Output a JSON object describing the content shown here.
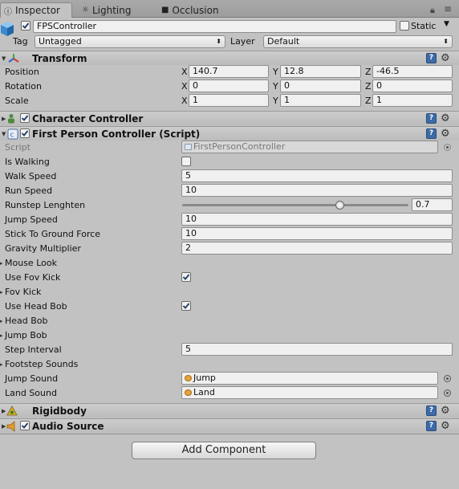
{
  "tabs": [
    {
      "label": "Inspector",
      "icon": "info-icon"
    },
    {
      "label": "Lighting",
      "icon": "lighting-icon"
    },
    {
      "label": "Occlusion",
      "icon": "occlusion-icon"
    }
  ],
  "header": {
    "object_name": "FPSController",
    "active": true,
    "static_label": "Static",
    "tag_label": "Tag",
    "tag_value": "Untagged",
    "layer_label": "Layer",
    "layer_value": "Default"
  },
  "transform": {
    "title": "Transform",
    "position_label": "Position",
    "rotation_label": "Rotation",
    "scale_label": "Scale",
    "x": "X",
    "y": "Y",
    "z": "Z",
    "position": {
      "x": "140.7",
      "y": "12.8",
      "z": "-46.5"
    },
    "rotation": {
      "x": "0",
      "y": "0",
      "z": "0"
    },
    "scale": {
      "x": "1",
      "y": "1",
      "z": "1"
    }
  },
  "character_controller": {
    "title": "Character Controller",
    "enabled": true
  },
  "fps_controller": {
    "title": "First Person Controller (Script)",
    "enabled": true,
    "script_label": "Script",
    "script_value": "FirstPersonController",
    "is_walking_label": "Is Walking",
    "walk_speed_label": "Walk Speed",
    "walk_speed": "5",
    "run_speed_label": "Run Speed",
    "run_speed": "10",
    "runstep_label": "Runstep Lenghten",
    "runstep_value": "0.7",
    "runstep_fraction": 0.7,
    "jump_speed_label": "Jump Speed",
    "jump_speed": "10",
    "stick_label": "Stick To Ground Force",
    "stick_value": "10",
    "gravity_label": "Gravity Multiplier",
    "gravity_value": "2",
    "mouse_look_label": "Mouse Look",
    "use_fov_kick_label": "Use Fov Kick",
    "fov_kick_label": "Fov Kick",
    "use_head_bob_label": "Use Head Bob",
    "head_bob_label": "Head Bob",
    "jump_bob_label": "Jump Bob",
    "step_interval_label": "Step Interval",
    "step_interval": "5",
    "footstep_label": "Footstep Sounds",
    "jump_sound_label": "Jump Sound",
    "jump_sound": "Jump",
    "land_sound_label": "Land Sound",
    "land_sound": "Land"
  },
  "rigidbody": {
    "title": "Rigidbody"
  },
  "audio_source": {
    "title": "Audio Source",
    "enabled": true
  },
  "add_component": "Add Component"
}
